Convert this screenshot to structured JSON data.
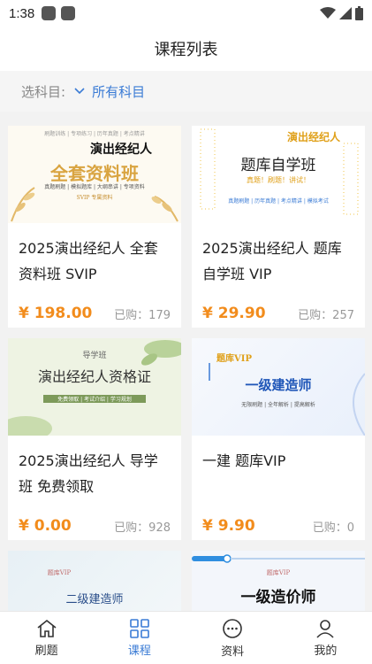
{
  "status": {
    "time": "1:38"
  },
  "header": {
    "title": "课程列表"
  },
  "filter": {
    "label": "选科目:",
    "value": "所有科目"
  },
  "courses": [
    {
      "title": "2025演出经纪人 全套资料班 SVIP",
      "price": "¥ 198.00",
      "sold": "已购：179",
      "image": {
        "headline": "全套资料班",
        "brand": "演出经纪人",
        "tags": "真题刷题 | 模拟题库 | 大纲串讲 | 专项资料",
        "badge": "SVIP 专属资料",
        "top": "刷题训练 | 专项练习 | 历年真题 | 考点精讲"
      }
    },
    {
      "title": "2025演出经纪人 题库自学班 VIP",
      "price": "¥ 29.90",
      "sold": "已购：257",
      "image": {
        "headline": "题库自学班",
        "brand": "演出经纪人",
        "sub": "真题！刷题！讲试！",
        "tags": "真题刷题 | 历年真题 | 考点精讲 | 模拟考试"
      }
    },
    {
      "title": "2025演出经纪人 导学班 免费领取",
      "price": "¥ 0.00",
      "sold": "已购：928",
      "image": {
        "headline": "演出经纪人资格证",
        "top": "导学班",
        "tags": "免费领取 | 考试介绍 | 学习规划"
      }
    },
    {
      "title": "一建 题库VIP",
      "price": "¥ 9.90",
      "sold": "已购：0",
      "image": {
        "headline": "一级建造师",
        "top": "题库VIP",
        "tags": "无限刷题 | 全年解析 | 提高解析"
      }
    },
    {
      "title": "",
      "price": "",
      "sold": "",
      "image": {
        "headline": "二级建造师",
        "top": "题库VIP"
      }
    },
    {
      "title": "",
      "price": "",
      "sold": "",
      "image": {
        "headline": "一级造价师",
        "top": "题库VIP"
      }
    }
  ],
  "tabs": [
    {
      "label": "刷题",
      "icon": "home-icon"
    },
    {
      "label": "课程",
      "icon": "grid-icon"
    },
    {
      "label": "资料",
      "icon": "chat-icon"
    },
    {
      "label": "我的",
      "icon": "user-icon"
    }
  ],
  "colors": {
    "accent": "#3a7bd5",
    "price": "#f28c1c"
  }
}
